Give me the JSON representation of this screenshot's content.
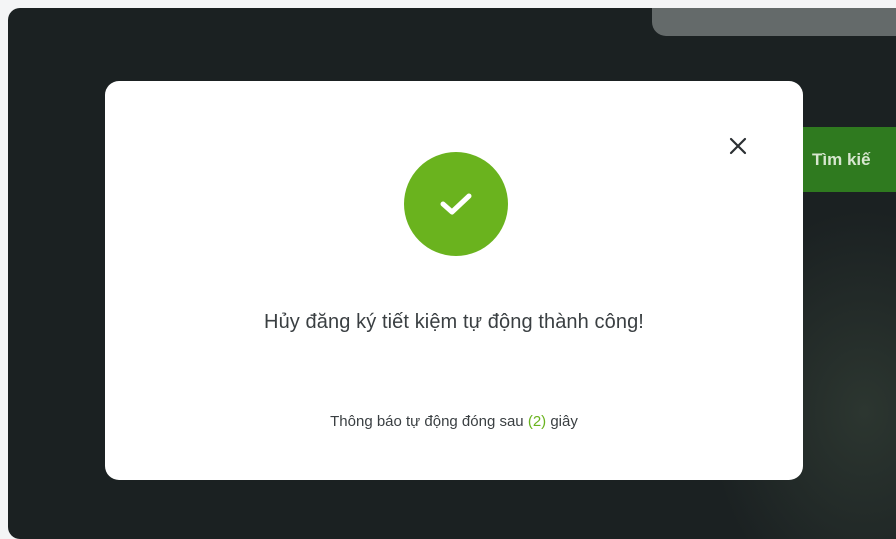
{
  "background": {
    "search_button_label": "Tìm kiế"
  },
  "dialog": {
    "close_icon": "close-icon",
    "status_icon": "check-circle-icon",
    "message": "Hủy đăng ký tiết kiệm tự động thành công!",
    "countdown": {
      "prefix": "Thông báo tự động đóng sau",
      "open_paren": "(",
      "seconds": "2",
      "close_paren": ")",
      "suffix": "giây"
    }
  },
  "colors": {
    "success_green": "#6ab31e",
    "overlay": "#1b2122",
    "background_button": "#2f7a1f"
  }
}
